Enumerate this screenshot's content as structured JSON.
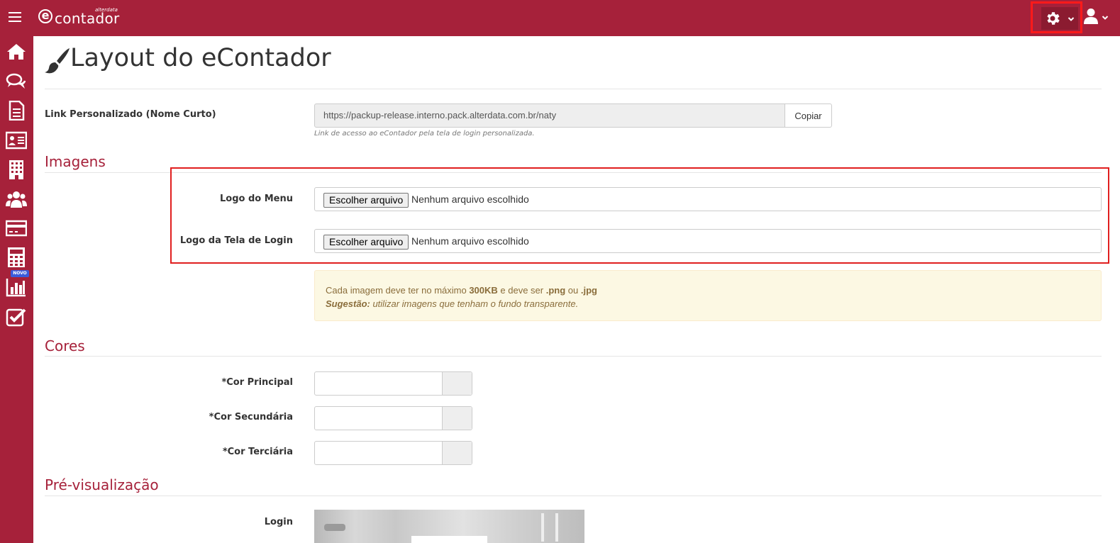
{
  "app": {
    "logo_word": "contador",
    "logo_letter": "e",
    "logo_sub": "alterdata"
  },
  "page": {
    "title": "Layout do eContador"
  },
  "link_section": {
    "label": "Link Personalizado (Nome Curto)",
    "value": "https://packup-release.interno.pack.alterdata.com.br/naty",
    "copy_label": "Copiar",
    "help": "Link de acesso ao eContador pela tela de login personalizada."
  },
  "images_section": {
    "title": "Imagens",
    "fields": [
      {
        "label": "Logo do Menu",
        "button": "Escolher arquivo",
        "status": "Nenhum arquivo escolhido"
      },
      {
        "label": "Logo da Tela de Login",
        "button": "Escolher arquivo",
        "status": "Nenhum arquivo escolhido"
      }
    ],
    "alert": {
      "line1_a": "Cada imagem deve ter no máximo ",
      "line1_b": "300KB",
      "line1_c": " e deve ser ",
      "line1_d": ".png",
      "line1_e": " ou ",
      "line1_f": ".jpg",
      "line2_a": "Sugestão:",
      "line2_b": " utilizar imagens que tenham o fundo transparente."
    }
  },
  "colors_section": {
    "title": "Cores",
    "fields": [
      {
        "label": "*Cor Principal",
        "value": ""
      },
      {
        "label": "*Cor Secundária",
        "value": ""
      },
      {
        "label": "*Cor Terciária",
        "value": ""
      }
    ]
  },
  "preview_section": {
    "title": "Pré-visualização",
    "login_label": "Login"
  },
  "sidebar": {
    "badge": "NOVO",
    "items": [
      "home-icon",
      "chat-icon",
      "document-icon",
      "contact-card-icon",
      "building-icon",
      "users-icon",
      "credit-card-icon",
      "calculator-icon",
      "bar-chart-icon",
      "checkbox-icon"
    ]
  },
  "colors": {
    "brand": "#a6213a",
    "highlight": "#e01f1f",
    "alert_bg": "#fcf8e3",
    "alert_text": "#8a6d3b"
  }
}
